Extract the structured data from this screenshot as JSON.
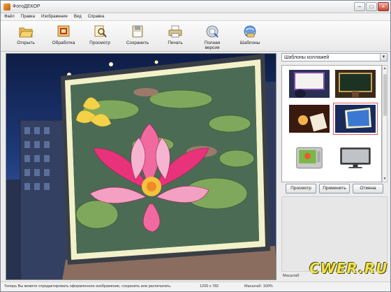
{
  "window": {
    "title": "ФотоДЕКОР"
  },
  "menu": [
    "Файл",
    "Правка",
    "Изображение",
    "Вид",
    "Справка"
  ],
  "toolbar": [
    {
      "label": "Открыть",
      "icon": "folder-open-icon"
    },
    {
      "label": "Обработка",
      "icon": "processing-icon"
    },
    {
      "label": "Просмотр",
      "icon": "preview-icon"
    },
    {
      "label": "Сохранить",
      "icon": "save-icon"
    },
    {
      "label": "Печать",
      "icon": "printer-icon"
    },
    {
      "label": "Полная версия",
      "icon": "full-version-icon"
    },
    {
      "label": "Шаблоны",
      "icon": "templates-icon"
    }
  ],
  "panel": {
    "combo_value": "Шаблоны коллажей",
    "buttons": {
      "preview": "Просмотр",
      "apply": "Применить",
      "cancel": "Отмена"
    },
    "zoom_label": "Масштаб"
  },
  "status": {
    "hint": "Теперь Вы можете отредактировать оформленное изображение, сохранить или распечатать.",
    "size": "1200 x 782",
    "zoom": "Масштаб: 100%"
  },
  "watermark": "CWER.RU",
  "colors": {
    "accent": "#e15a5a",
    "sky": "#1e3a7a",
    "lotus": "#e8337a"
  }
}
